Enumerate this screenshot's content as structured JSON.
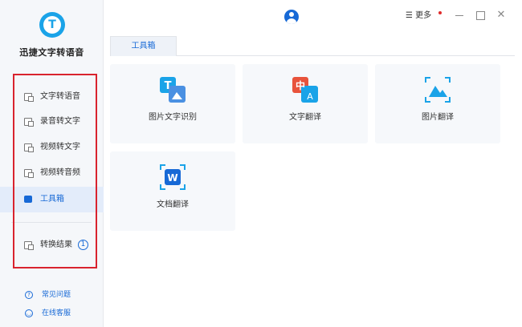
{
  "app": {
    "name": "迅捷文字转语音",
    "logo_letter": "T"
  },
  "sidebar": {
    "items": [
      {
        "label": "文字转语音",
        "icon": "text-to-speech-icon"
      },
      {
        "label": "录音转文字",
        "icon": "recording-to-text-icon"
      },
      {
        "label": "视频转文字",
        "icon": "video-to-text-icon"
      },
      {
        "label": "视频转音频",
        "icon": "video-to-audio-icon"
      },
      {
        "label": "工具箱",
        "icon": "toolbox-icon",
        "active": true
      },
      {
        "label": "转换结果",
        "icon": "result-document-icon",
        "badge": "1"
      }
    ],
    "help": [
      {
        "label": "常见问题",
        "icon": "question-circle-icon",
        "glyph": "?"
      },
      {
        "label": "在线客服",
        "icon": "headset-icon",
        "glyph": "◡"
      }
    ]
  },
  "titlebar": {
    "more_label": "☰ 更多",
    "close_glyph": "✕"
  },
  "tabs": [
    {
      "label": "工具箱",
      "active": true
    }
  ],
  "tools": [
    {
      "label": "图片文字识别",
      "icon": "image-ocr-icon",
      "glyph_a": "T"
    },
    {
      "label": "文字翻译",
      "icon": "text-translate-icon",
      "glyph_a": "中",
      "glyph_b": "A"
    },
    {
      "label": "图片翻译",
      "icon": "image-translate-icon"
    },
    {
      "label": "文档翻译",
      "icon": "document-translate-icon",
      "glyph_a": "W"
    }
  ],
  "colors": {
    "accent": "#1769d6",
    "logo": "#1aa3e8",
    "highlight_border": "#d9232e",
    "card_bg": "#f6f8fb",
    "sidebar_bg": "#f5f7fa"
  }
}
